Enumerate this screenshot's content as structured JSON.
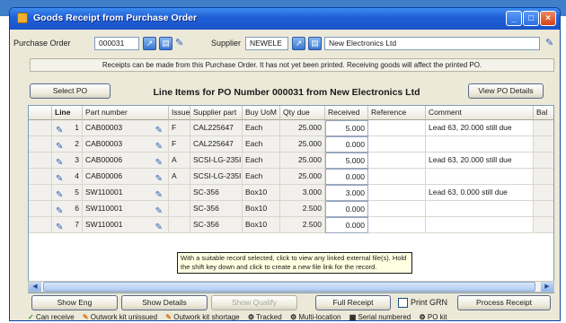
{
  "window": {
    "title": "Goods Receipt from Purchase Order"
  },
  "header": {
    "po_label": "Purchase Order",
    "po_value": "000031",
    "supplier_label": "Supplier",
    "supplier_code": "NEWELE",
    "supplier_name": "New Electronics Ltd"
  },
  "notice": "Receipts can be made from this Purchase Order. It has not yet been printed. Receiving goods will affect the printed PO.",
  "toolbar": {
    "select_po": "Select PO",
    "grid_title": "Line Items for PO Number 000031 from New Electronics Ltd",
    "view_po_details": "View PO Details"
  },
  "columns": [
    "Line",
    "Part number",
    "Issue",
    "Supplier part",
    "Buy UoM",
    "Qty due",
    "Received",
    "Reference",
    "Comment",
    "Bal"
  ],
  "rows": [
    {
      "line": "1",
      "part": "CAB00003",
      "issue": "F",
      "supplier_part": "CAL225647",
      "uom": "Each",
      "qty_due": "25.000",
      "received": "5.000",
      "reference": "",
      "comment": "Lead 63, 20.000 still due"
    },
    {
      "line": "2",
      "part": "CAB00003",
      "issue": "F",
      "supplier_part": "CAL225647",
      "uom": "Each",
      "qty_due": "25.000",
      "received": "0.000",
      "reference": "",
      "comment": ""
    },
    {
      "line": "3",
      "part": "CAB00006",
      "issue": "A",
      "supplier_part": "SCSI-LG-235I",
      "uom": "Each",
      "qty_due": "25.000",
      "received": "5.000",
      "reference": "",
      "comment": "Lead 63, 20.000 still due"
    },
    {
      "line": "4",
      "part": "CAB00006",
      "issue": "A",
      "supplier_part": "SCSI-LG-235I",
      "uom": "Each",
      "qty_due": "25.000",
      "received": "0.000",
      "reference": "",
      "comment": ""
    },
    {
      "line": "5",
      "part": "SW110001",
      "issue": "",
      "supplier_part": "SC-356",
      "uom": "Box10",
      "qty_due": "3.000",
      "received": "3.000",
      "reference": "",
      "comment": "Lead 63, 0.000 still due"
    },
    {
      "line": "6",
      "part": "SW110001",
      "issue": "",
      "supplier_part": "SC-356",
      "uom": "Box10",
      "qty_due": "2.500",
      "received": "0.000",
      "reference": "",
      "comment": ""
    },
    {
      "line": "7",
      "part": "SW110001",
      "issue": "",
      "supplier_part": "SC-356",
      "uom": "Box10",
      "qty_due": "2.500",
      "received": "0.000",
      "reference": "",
      "comment": ""
    }
  ],
  "tooltip": "With a suitable record selected, click to view any linked external file(s). Hold the shift key down and click to create a new file link for the record.",
  "bottom": {
    "show_eng": "Show Eng",
    "show_details": "Show Details",
    "show_qualify": "Show Qualify",
    "full_receipt": "Full Receipt",
    "print_grn": "Print GRN",
    "process_receipt": "Process Receipt"
  },
  "legend": [
    {
      "glyph": "✓",
      "text": "Can receive"
    },
    {
      "glyph": "✎",
      "text": "Outwork kit unissued"
    },
    {
      "glyph": "✎",
      "text": "Outwork kit shortage"
    },
    {
      "glyph": "⚙",
      "text": "Tracked"
    },
    {
      "glyph": "⚙",
      "text": "Multi-location"
    },
    {
      "glyph": "▦",
      "text": "Serial numbered"
    },
    {
      "glyph": "⚙",
      "text": "PO kit"
    }
  ],
  "colors": {
    "title_bar": "#1f5fd6",
    "grid_icon": "#2c5fb8",
    "can_receive": "#2a9a2a"
  }
}
